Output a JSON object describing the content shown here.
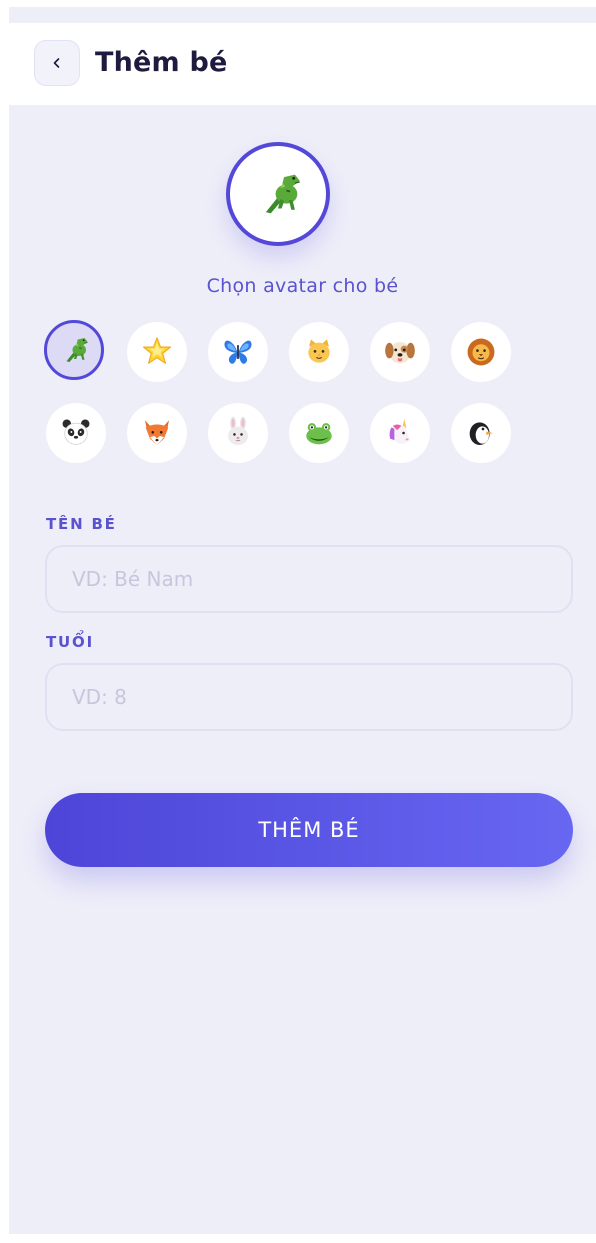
{
  "header": {
    "back_icon": "chevron-left-icon",
    "title": "Thêm bé"
  },
  "avatar_picker": {
    "selected": "dinosaur",
    "caption": "Chọn avatar cho bé",
    "options": [
      "dinosaur",
      "star",
      "butterfly",
      "cat",
      "dog",
      "lion",
      "panda",
      "fox",
      "rabbit",
      "frog",
      "unicorn",
      "penguin"
    ]
  },
  "form": {
    "name_label": "TÊN BÉ",
    "name_placeholder": "VD: Bé Nam",
    "name_value": "",
    "age_label": "TUỔI",
    "age_placeholder": "VD: 8",
    "age_value": ""
  },
  "submit_label": "THÊM BÉ",
  "colors": {
    "accent": "#5448d9",
    "background": "#eeeef9",
    "title": "#1e1b3f"
  }
}
